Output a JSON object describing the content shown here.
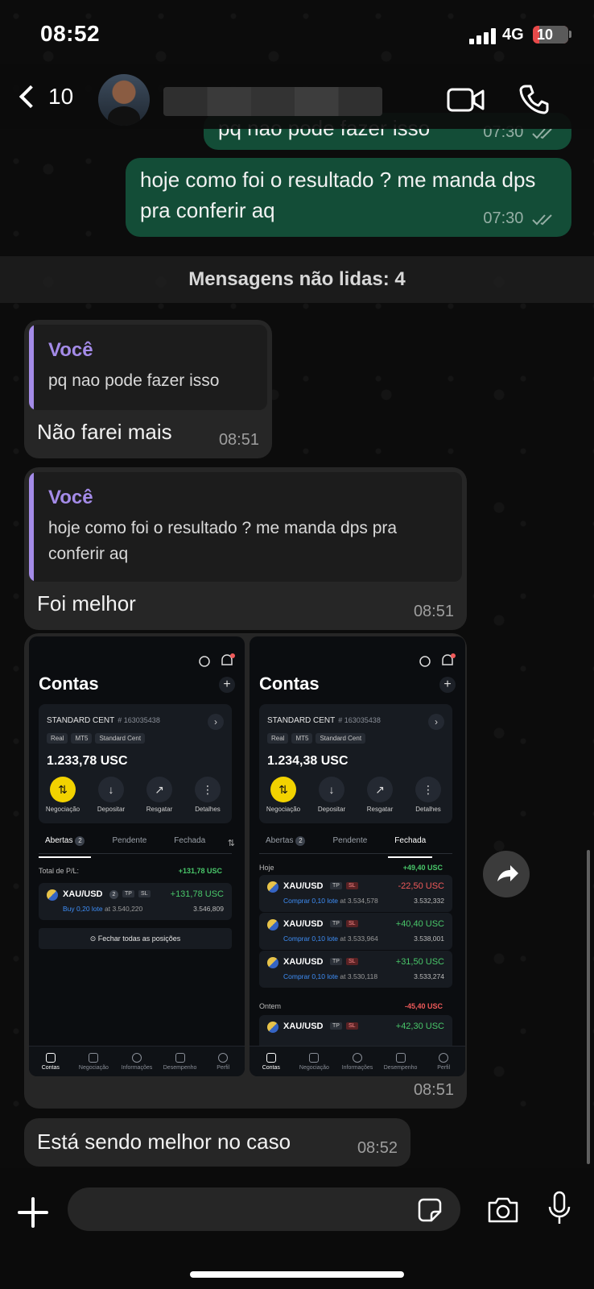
{
  "status_bar": {
    "time": "08:52",
    "network": "4G",
    "battery": "10"
  },
  "header": {
    "back_count": "10"
  },
  "messages": {
    "prev_out": {
      "text": "pq nao pode fazer isso",
      "time": "07:30"
    },
    "out_1": {
      "text": "hoje como foi o resultado ? me manda dps pra conferir aq",
      "time": "07:30"
    },
    "unread_label": "Mensagens não lidas: 4",
    "in_1": {
      "quote_author": "Você",
      "quote_text": "pq nao pode fazer isso",
      "text": "Não farei mais",
      "time": "08:51"
    },
    "in_2": {
      "quote_author": "Você",
      "quote_text": "hoje como foi o resultado ? me manda dps pra conferir aq",
      "text": "Foi melhor",
      "time": "08:51"
    },
    "images": {
      "time": "08:51"
    },
    "in_3": {
      "text": "Está sendo melhor no caso",
      "time": "08:52"
    }
  },
  "shots": [
    {
      "title": "Contas",
      "account": "STANDARD CENT",
      "account_no": "# 163035438",
      "tags": [
        "Real",
        "MT5",
        "Standard Cent"
      ],
      "balance": "1.233,78 USC",
      "actions": [
        "Negociação",
        "Depositar",
        "Resgatar",
        "Detalhes"
      ],
      "tabs": {
        "open": "Abertas",
        "open_count": "2",
        "pending": "Pendente",
        "closed": "Fechada",
        "active": "open"
      },
      "total_label": "Total de P/L:",
      "total_value": "+131,78 USC",
      "position": {
        "symbol": "XAU/USD",
        "count": "2",
        "tp": "TP",
        "sl": "SL",
        "pl": "+131,78 USC",
        "side": "Buy 0,20 lote",
        "at": "at 3.540,220",
        "current": "3.546,809"
      },
      "close_all": "Fechar todas as posições"
    },
    {
      "title": "Contas",
      "account": "STANDARD CENT",
      "account_no": "# 163035438",
      "tags": [
        "Real",
        "MT5",
        "Standard Cent"
      ],
      "balance": "1.234,38 USC",
      "actions": [
        "Negociação",
        "Depositar",
        "Resgatar",
        "Detalhes"
      ],
      "tabs": {
        "open": "Abertas",
        "open_count": "2",
        "pending": "Pendente",
        "closed": "Fechada",
        "active": "closed"
      },
      "today_label": "Hoje",
      "today_value": "+49,40 USC",
      "closed_positions": [
        {
          "symbol": "XAU/USD",
          "tp": "TP",
          "sl": "SL",
          "pl": "-22,50 USC",
          "side": "Comprar 0,10 lote",
          "at": "at 3.534,578",
          "current": "3.532,332"
        },
        {
          "symbol": "XAU/USD",
          "tp": "TP",
          "sl": "SL",
          "pl": "+40,40 USC",
          "side": "Comprar 0,10 lote",
          "at": "at 3.533,964",
          "current": "3.538,001"
        },
        {
          "symbol": "XAU/USD",
          "tp": "TP",
          "sl": "SL",
          "pl": "+31,50 USC",
          "side": "Comprar 0,10 lote",
          "at": "at 3.530,118",
          "current": "3.533,274"
        }
      ],
      "yesterday_label": "Ontem",
      "yesterday_value": "-45,40 USC",
      "yesterday_first": {
        "symbol": "XAU/USD",
        "tp": "TP",
        "sl": "SL",
        "pl": "+42,30 USC"
      }
    }
  ],
  "bottom_nav": [
    "Contas",
    "Negociação",
    "Informações",
    "Desempenho",
    "Perfil"
  ],
  "composer": {
    "placeholder": ""
  },
  "colors": {
    "outgoing_bubble": "#134d37",
    "incoming_bubble": "#262626",
    "quote_accent": "#a48be8",
    "profit": "#49c76a",
    "loss": "#f05a5a"
  }
}
